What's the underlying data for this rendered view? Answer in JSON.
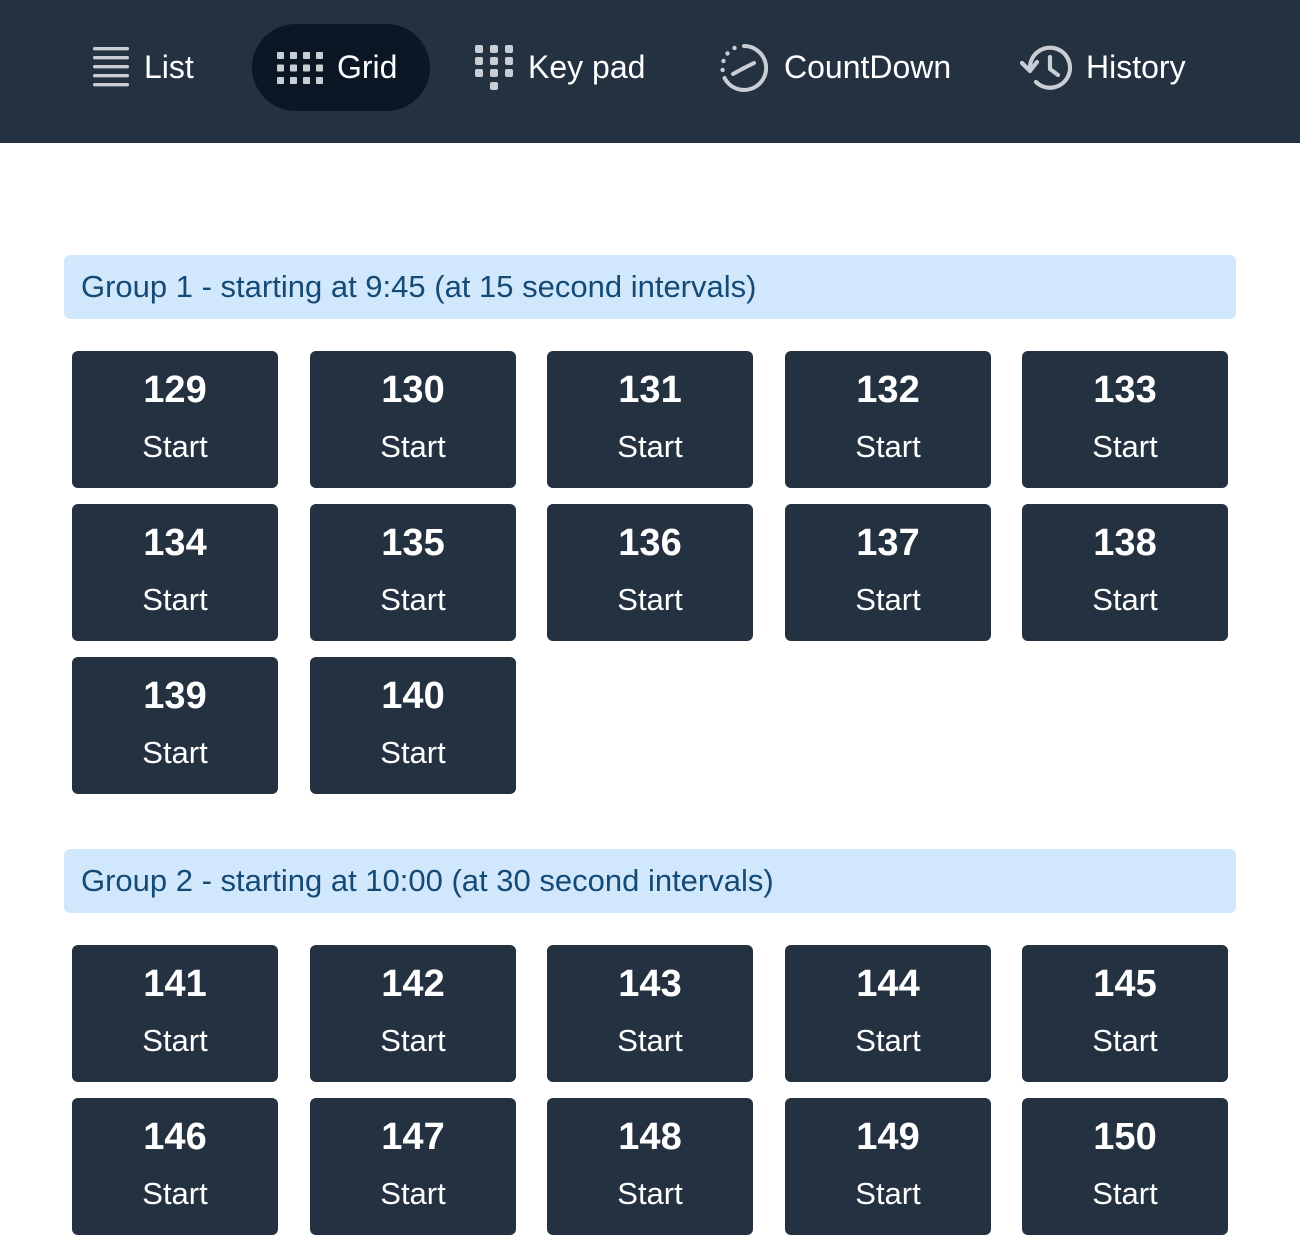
{
  "nav": {
    "tabs": [
      {
        "label": "List",
        "icon": "list-icon",
        "active": false
      },
      {
        "label": "Grid",
        "icon": "grid-icon",
        "active": true
      },
      {
        "label": "Key pad",
        "icon": "keypad-icon",
        "active": false
      },
      {
        "label": "CountDown",
        "icon": "countdown-timer-icon",
        "active": false
      },
      {
        "label": "History",
        "icon": "history-icon",
        "active": false
      }
    ]
  },
  "colors": {
    "navbar": "#243140",
    "active_tab": "#0b1724",
    "tile": "#243140",
    "group_header_bg": "#d1e8fc",
    "group_header_text": "#154a76"
  },
  "groups": [
    {
      "title": "Group 1 - starting at 9:45 (at 15 second intervals)",
      "entries": [
        {
          "number": "129",
          "action": "Start"
        },
        {
          "number": "130",
          "action": "Start"
        },
        {
          "number": "131",
          "action": "Start"
        },
        {
          "number": "132",
          "action": "Start"
        },
        {
          "number": "133",
          "action": "Start"
        },
        {
          "number": "134",
          "action": "Start"
        },
        {
          "number": "135",
          "action": "Start"
        },
        {
          "number": "136",
          "action": "Start"
        },
        {
          "number": "137",
          "action": "Start"
        },
        {
          "number": "138",
          "action": "Start"
        },
        {
          "number": "139",
          "action": "Start"
        },
        {
          "number": "140",
          "action": "Start"
        }
      ]
    },
    {
      "title": "Group 2 - starting at 10:00 (at 30 second intervals)",
      "entries": [
        {
          "number": "141",
          "action": "Start"
        },
        {
          "number": "142",
          "action": "Start"
        },
        {
          "number": "143",
          "action": "Start"
        },
        {
          "number": "144",
          "action": "Start"
        },
        {
          "number": "145",
          "action": "Start"
        },
        {
          "number": "146",
          "action": "Start"
        },
        {
          "number": "147",
          "action": "Start"
        },
        {
          "number": "148",
          "action": "Start"
        },
        {
          "number": "149",
          "action": "Start"
        },
        {
          "number": "150",
          "action": "Start"
        }
      ]
    }
  ]
}
